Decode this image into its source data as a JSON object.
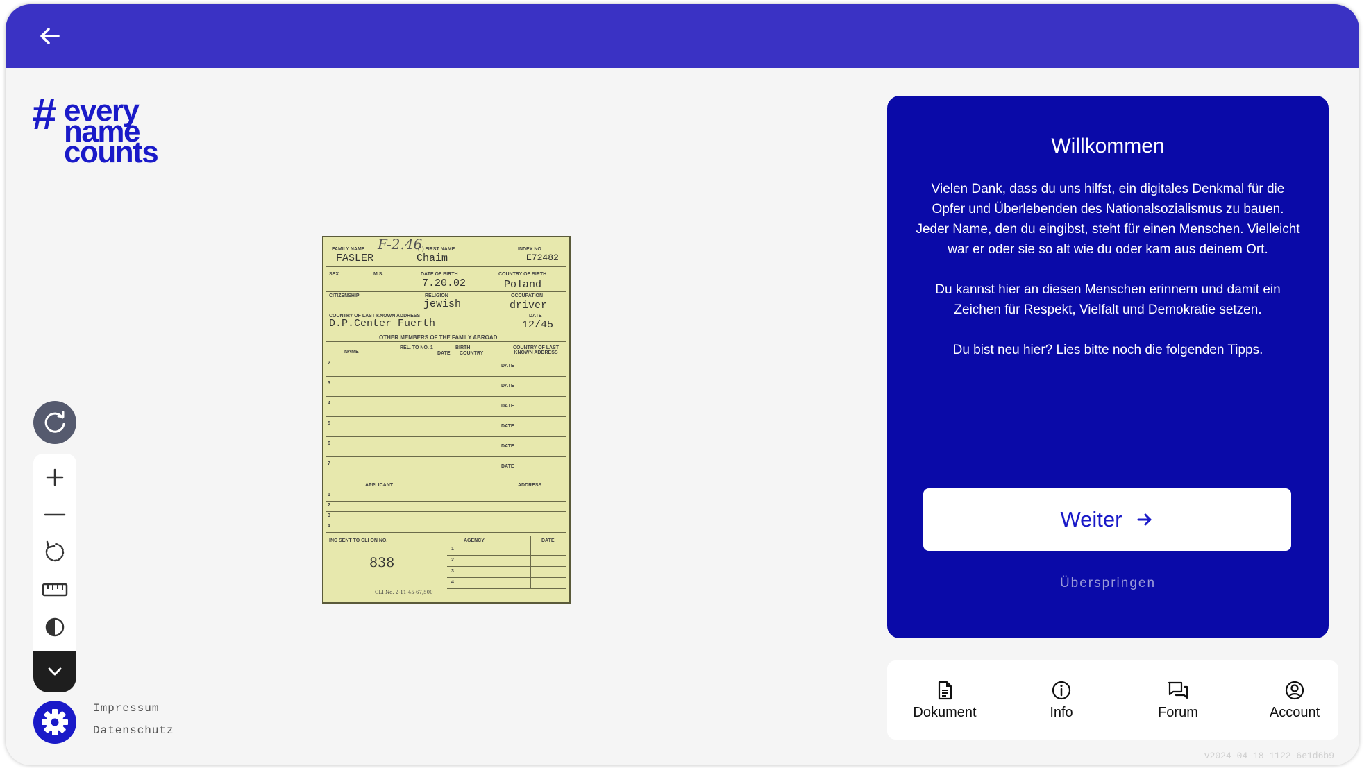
{
  "logo": {
    "hash": "#",
    "line1": "every",
    "line2": "name",
    "line3": "counts"
  },
  "document": {
    "labels": {
      "family_name": "FAMILY NAME",
      "first_name": "(1) FIRST NAME",
      "index_no": "INDEX NO:",
      "sex": "SEX",
      "ms": "M.S.",
      "date_of_birth": "DATE OF BIRTH",
      "country_of_birth": "COUNTRY OF BIRTH",
      "citizenship": "CITIZENSHIP",
      "religion": "RELIGION",
      "occupation": "OCCUPATION",
      "country_last_address": "COUNTRY OF LAST KNOWN ADDRESS",
      "date": "DATE",
      "other_members": "OTHER MEMBERS OF THE FAMILY ABROAD",
      "name": "NAME",
      "rel": "REL. TO NO. 1",
      "birth": "BIRTH",
      "birth_date": "DATE",
      "birth_country": "COUNTRY",
      "country_last": "COUNTRY OF LAST KNOWN ADDRESS",
      "applicant": "APPLICANT",
      "address": "ADDRESS",
      "inc_sent": "INC SENT TO CLI ON NO.",
      "agency": "AGENCY",
      "footer_print": "CLI No. 2-11-45-67,500"
    },
    "values": {
      "handwritten": "F-2.46",
      "family_name": "FASLER",
      "first_name": "Chaim",
      "index_no": "E72482",
      "date_of_birth": "7.20.02",
      "country_of_birth": "Poland",
      "religion": "jewish",
      "occupation": "driver",
      "last_address": "D.P.Center Fuerth",
      "date": "12/45",
      "inc_no": "838"
    },
    "row_numbers": [
      "2",
      "3",
      "4",
      "5",
      "6",
      "7"
    ],
    "applicant_numbers": [
      "1",
      "2",
      "3",
      "4"
    ],
    "agency_numbers": [
      "1",
      "2",
      "3",
      "4"
    ]
  },
  "welcome": {
    "title": "Willkommen",
    "p1": "Vielen Dank, dass du uns hilfst, ein digitales Denkmal für die Opfer und Überlebenden des Nationalsozialismus zu bauen.",
    "p1b": "Jeder Name, den du eingibst, steht für einen Menschen. Vielleicht war er oder sie so alt wie du oder kam aus deinem Ort.",
    "p2": "Du kannst hier an diesen Menschen erinnern und damit ein Zeichen für Respekt, Vielfalt und Demokratie setzen.",
    "p3": "Du bist neu hier? Lies bitte noch die folgenden Tipps.",
    "next_label": "Weiter",
    "skip_label": "Überspringen"
  },
  "nav": [
    {
      "label": "Dokument",
      "icon": "document-icon"
    },
    {
      "label": "Info",
      "icon": "info-icon"
    },
    {
      "label": "Forum",
      "icon": "forum-icon"
    },
    {
      "label": "Account",
      "icon": "account-icon"
    }
  ],
  "footer": {
    "impressum": "Impressum",
    "datenschutz": "Datenschutz"
  },
  "version": "v2024-04-18-1122-6e1d6b9",
  "colors": {
    "topbar": "#3a32c4",
    "panel": "#0a0aa8",
    "brand": "#1a1ac8"
  }
}
